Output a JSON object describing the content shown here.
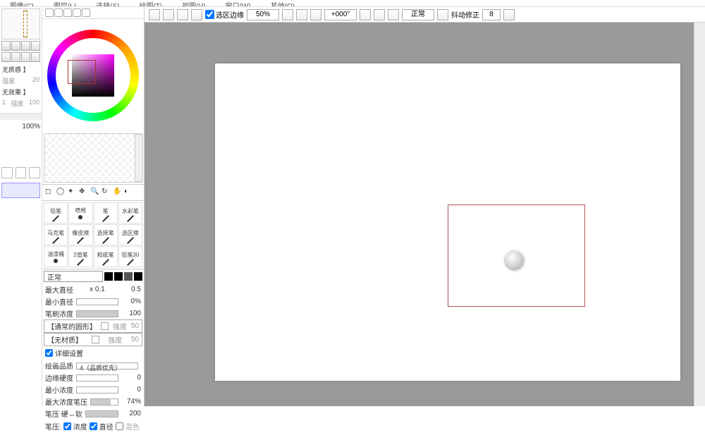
{
  "menu": {
    "items": [
      "图像(C)",
      "图层(L)",
      "选择(S)",
      "绘图(T)",
      "视图(V)",
      "窗口(W)",
      "其他(O)"
    ]
  },
  "topbar": {
    "selection_edge_label": "选区边缘",
    "zoom": "50%",
    "angle": "+000°",
    "mode": "正常",
    "stabilizer_label": "抖动修正",
    "stabilizer_value": "8"
  },
  "left": {
    "texture_label": "无质感 】",
    "strength": "强度",
    "texture_val": "20",
    "effect_label": "无效果 】",
    "effect_idx": "1",
    "effect_val": "100",
    "zoom_percent": "100%"
  },
  "brushes": {
    "cells": [
      "铅笔",
      "喷枪",
      "笔",
      "水彩笔",
      "马克笔",
      "橡皮擦",
      "选择笔",
      "选区擦",
      "油漆桶",
      "2值笔",
      "和纸笔",
      "铅笔30"
    ],
    "mode": "正常"
  },
  "props": {
    "max_size_label": "最大直径",
    "max_size_mult": "x 0.1",
    "max_size_val": "0.5",
    "min_size_label": "最小直径",
    "min_size_val": "0%",
    "density_label": "笔刷浓度",
    "density_val": "100",
    "shape_label": "【通常的圆形】",
    "shape_str": "50",
    "texture_label": "【无材质】",
    "texture_str": "50",
    "detail_label": "详细设置",
    "quality_label": "绘画品质",
    "quality_val": "4（品质优先）",
    "edge_label": "边缘硬度",
    "edge_val": "0",
    "min_dens_label": "最小浓度",
    "min_dens_val": "0",
    "max_dens_press_label": "最大浓度笔压",
    "max_dens_press_val": "74%",
    "press_hard_label": "笔压 硬⇔软",
    "press_hard_val": "200",
    "pressure_label": "笔压:",
    "cb_density": "浓度",
    "cb_diameter": "直径",
    "cb_blend": "混色",
    "strength": "强度"
  }
}
